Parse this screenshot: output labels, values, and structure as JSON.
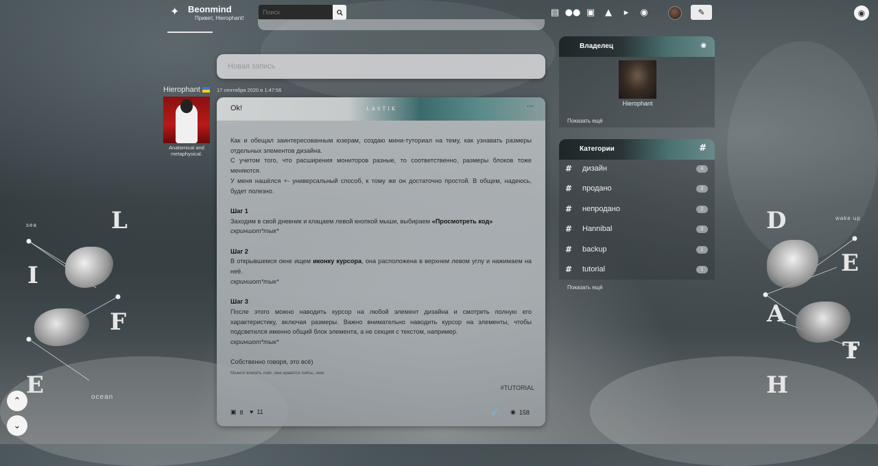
{
  "nav": {
    "brand": "Beonmind",
    "greeting": "Привет, Hierophant!",
    "search_placeholder": "Поиск",
    "icons": [
      "diary-icon",
      "community-icon",
      "messages-icon",
      "bell-icon",
      "megaphone-icon",
      "friends-icon"
    ]
  },
  "composer": {
    "placeholder": "Новая запись"
  },
  "post": {
    "author": "Hierophant",
    "author_subtitle": "Anatomical and metaphysical.",
    "date": "17 сентября 2020 в 1:47:56",
    "title": "Ok!",
    "header_brand": "LASTIK",
    "intro1": "Как и обещал заинтересованным юзерам, создаю мини-туториал на тему, как узнавать размеры отдельных элементов дизайна.",
    "intro2": "С учетом того, что расширения мониторов разные, то соответственно, размеры блоков тоже меняются.",
    "intro3": "У меня нашёлся +- универсальный способ, к тому же он достаточно простой. В общем, надеюсь, будет полезно.",
    "step1_title": "Шаг 1",
    "step1_text": "Заходим в свой дневник и клацаем левой кнопкой мыши, выбираем ",
    "step1_bold": "«Просмотреть код»",
    "step1_shot": "скриншот*тык*",
    "step2_title": "Шаг 2",
    "step2_text_a": "В открывшемся окне ищем ",
    "step2_bold": "иконку курсора",
    "step2_text_b": ", она расположена в верхнем левом углу и нажимаем на неё.",
    "step2_shot": "скриншот*тык*",
    "step3_title": "Шаг 3",
    "step3_text": "После этого можно наводить курсор на любой элемент дизайна и смотреть полную его характеристику, включая размеры. Важно внимательно наводить курсор на элементы, чтобы подсветился именно общий блок элемента, а не секция с текстом, например.",
    "step3_shot": "скриншот*тык*",
    "outro": "Собственно говоря, это всё)",
    "small_note": "Можете влепить лойс, мне нравятся лойсы, хехе",
    "tag": "#TUTORIAL",
    "comments": "8",
    "likes": "11",
    "views": "158"
  },
  "sidebar": {
    "owner_title": "Владелец",
    "owner_name": "Hierophant",
    "owner_show_more": "Показать ещё",
    "categories_title": "Категории",
    "categories": [
      {
        "label": "дизайн",
        "count": "4"
      },
      {
        "label": "продано",
        "count": "3"
      },
      {
        "label": "непродано",
        "count": "2"
      },
      {
        "label": "Hannibal",
        "count": "2"
      },
      {
        "label": "backup",
        "count": "1"
      },
      {
        "label": "tutorial",
        "count": "1"
      }
    ],
    "categories_show_more": "Показать ещё"
  },
  "decor": {
    "left_letters": [
      "L",
      "I",
      "F",
      "E"
    ],
    "left_small_top": "sea",
    "left_small_bottom": "ocean",
    "right_letters": [
      "D",
      "E",
      "A",
      "T",
      "H"
    ],
    "right_small_top": "wake up"
  }
}
